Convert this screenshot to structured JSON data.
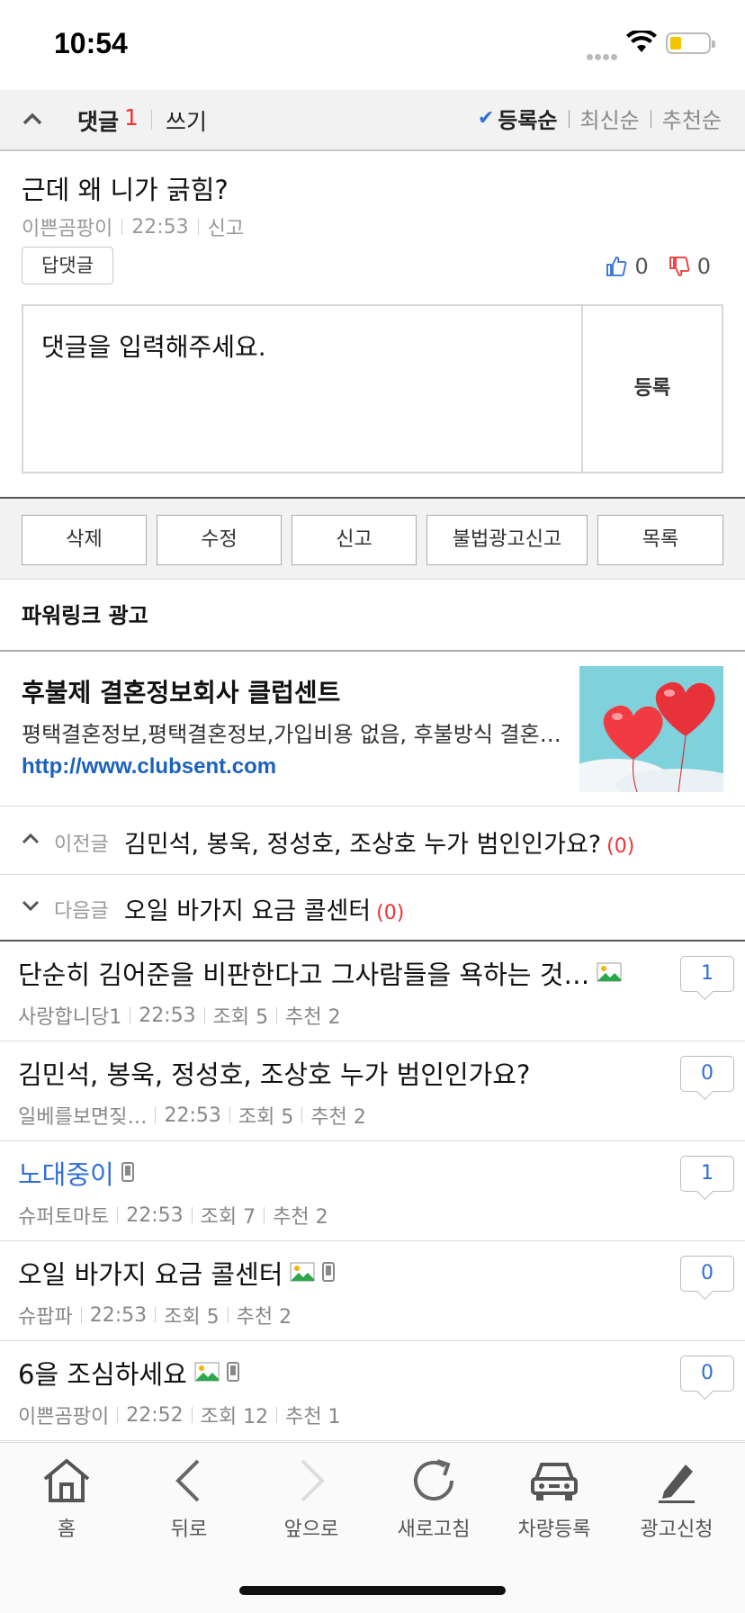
{
  "status_bar": {
    "time": "10:54"
  },
  "comment_header": {
    "label": "댓글",
    "count": "1",
    "write": "쓰기",
    "sort_options": [
      "등록순",
      "최신순",
      "추천순"
    ],
    "sort_selected": "등록순"
  },
  "comment": {
    "text": "근데 왜 니가 긁힘?",
    "author": "이쁜곰팡이",
    "time": "22:53",
    "report": "신고",
    "reply_label": "답댓글",
    "likes": "0",
    "dislikes": "0"
  },
  "reply_form": {
    "placeholder": "댓글을 입력해주세요.",
    "submit_label": "등록"
  },
  "actions": {
    "delete": "삭제",
    "edit": "수정",
    "report": "신고",
    "report_ad": "불법광고신고",
    "list": "목록"
  },
  "ad": {
    "section_title": "파워링크 광고",
    "headline": "후불제 결혼정보회사 클럽센트",
    "description": "평택결혼정보,평택결혼정보,가입비용 없음, 후불방식 결혼정보회사",
    "url": "http://www.clubsent.com"
  },
  "prev_post": {
    "label": "이전글",
    "title": "김민석, 봉욱, 정성호, 조상호 누가 범인인가요?",
    "count": "(0)"
  },
  "next_post": {
    "label": "다음글",
    "title": "오일 바가지 요금 콜센터",
    "count": "(0)"
  },
  "posts": [
    {
      "title": "단순히 김어준을 비판한다고 그사람들을 욕하는 것…",
      "author": "사랑합니당1",
      "time": "22:53",
      "views": "조회 5",
      "recommend": "추천 2",
      "comments": "1"
    },
    {
      "title": "김민석, 봉욱, 정성호, 조상호 누가 범인인가요?",
      "author": "일베를보면짖…",
      "time": "22:53",
      "views": "조회 5",
      "recommend": "추천 2",
      "comments": "0"
    },
    {
      "title": "노대중이",
      "author": "슈퍼토마토",
      "time": "22:53",
      "views": "조회 7",
      "recommend": "추천 2",
      "comments": "1"
    },
    {
      "title": "오일 바가지 요금 콜센터",
      "author": "슈팝파",
      "time": "22:53",
      "views": "조회 5",
      "recommend": "추천 2",
      "comments": "0"
    },
    {
      "title": "6을 조심하세요",
      "author": "이쁜곰팡이",
      "time": "22:52",
      "views": "조회 12",
      "recommend": "추천 1",
      "comments": "0"
    }
  ],
  "tabbar": {
    "home": "홈",
    "back": "뒤로",
    "forward": "앞으로",
    "refresh": "새로고침",
    "car_register": "차량등록",
    "ad_apply": "광고신청"
  },
  "colors": {
    "accent_blue": "#2f6ed8",
    "alert_red": "#e33333",
    "link_blue": "#1a62bd"
  }
}
